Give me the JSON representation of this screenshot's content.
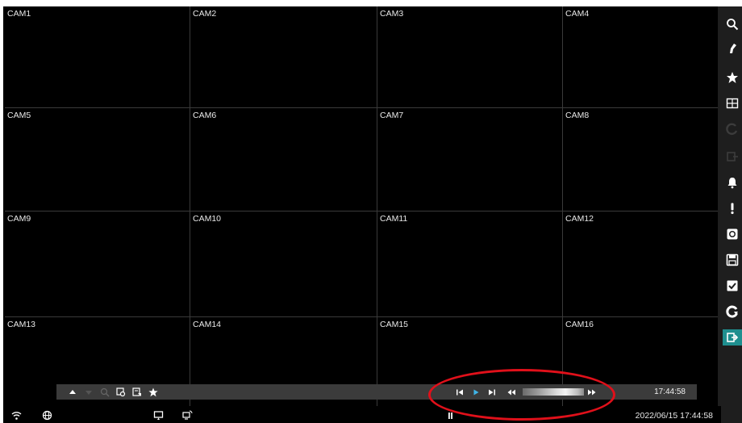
{
  "cameras": [
    "CAM1",
    "CAM2",
    "CAM3",
    "CAM4",
    "CAM5",
    "CAM6",
    "CAM7",
    "CAM8",
    "CAM9",
    "CAM10",
    "CAM11",
    "CAM12",
    "CAM13",
    "CAM14",
    "CAM15",
    "CAM16"
  ],
  "playbar": {
    "time": "17:44:58",
    "left_icons": [
      "arrow-up-icon",
      "arrow-down-icon",
      "zoom-icon",
      "snapshot-search-icon",
      "bookmark-list-icon",
      "star-icon"
    ],
    "controls": [
      "step-back-icon",
      "play-icon",
      "step-forward-icon",
      "rewind-icon",
      "fast-forward-icon"
    ]
  },
  "statusbar": {
    "datetime": "2022/06/15  17:44:58",
    "icons": [
      "wifi-icon",
      "network-globe-icon",
      "monitor-icon",
      "cast-icon",
      "pause-icon"
    ]
  },
  "right_sidebar": {
    "icons": [
      "search-icon",
      "ptz-icon",
      "favorite-star-icon",
      "layout-grid-icon",
      "refresh-icon",
      "export-icon",
      "alarm-bell-icon",
      "alert-icon",
      "record-icon",
      "save-icon",
      "checkbox-icon",
      "backup-icon",
      "exit-icon"
    ],
    "active": "exit-icon"
  },
  "colors": {
    "screen_bg": "#000000",
    "sidebar_bg": "#1e1e1e",
    "active_accent": "#1f8f8f",
    "playbar_bg": "#3b3b3b",
    "play_accent": "#3fb5e8",
    "annotation": "#e0101a"
  }
}
